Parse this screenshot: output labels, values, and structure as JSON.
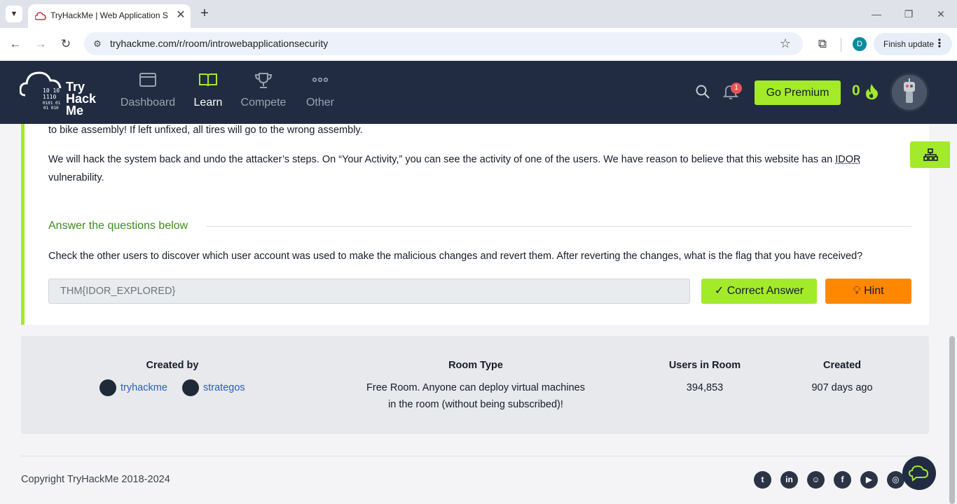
{
  "browser": {
    "tab_title": "TryHackMe | Web Application S",
    "url": "tryhackme.com/r/room/introwebapplicationsecurity",
    "profile_initial": "D",
    "finish_update": "Finish update"
  },
  "header": {
    "logo_text": [
      "Try",
      "Hack",
      "Me"
    ],
    "nav": [
      {
        "label": "Dashboard",
        "icon": "dashboard-icon"
      },
      {
        "label": "Learn",
        "icon": "book-icon"
      },
      {
        "label": "Compete",
        "icon": "trophy-icon"
      },
      {
        "label": "Other",
        "icon": "more-icon"
      }
    ],
    "notification_count": "1",
    "premium_label": "Go Premium",
    "streak": "0"
  },
  "task": {
    "para_top": "to bike assembly! If left unfixed, all tires will go to the wrong assembly.",
    "para_main_1": "We will hack the system back and undo the attacker’s steps. On “Your Activity,” you can see the activity of one of the users. We have reason to believe that this website has an ",
    "para_main_abbr": "IDOR",
    "para_main_2": "vulnerability.",
    "answer_title": "Answer the questions below",
    "question": "Check the other users to discover which user account was used to make the malicious changes and revert them. After reverting the changes, what is the flag that you have received?",
    "answer_value": "THM{IDOR_EXPLORED}",
    "correct_label": "Correct Answer",
    "hint_label": "Hint"
  },
  "room_info": {
    "created_by_label": "Created by",
    "creators": [
      "tryhackme",
      "strategos"
    ],
    "room_type_label": "Room Type",
    "room_type_line1": "Free Room. Anyone can deploy virtual machines",
    "room_type_line2": "in the room (without being subscribed)!",
    "users_label": "Users in Room",
    "users_value": "394,853",
    "created_label": "Created",
    "created_value": "907 days ago"
  },
  "footer": {
    "copyright": "Copyright TryHackMe 2018-2024",
    "socials": [
      "twitter-icon",
      "linkedin-icon",
      "discord-icon",
      "facebook-icon",
      "youtube-icon",
      "instagram-icon"
    ]
  },
  "colors": {
    "brand_green": "#a3ea2a",
    "header_bg": "#212c42",
    "hint_orange": "#ff8800",
    "link_blue": "#2d5db6"
  }
}
